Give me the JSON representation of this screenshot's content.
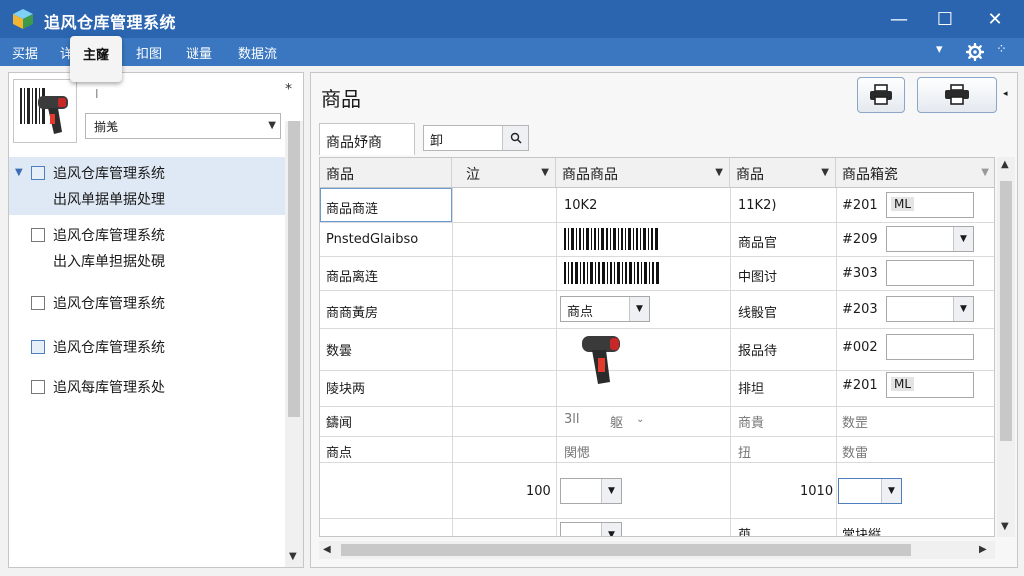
{
  "window": {
    "title": "追风仓库管理系统",
    "controls": {
      "minimize": "—",
      "maximize": "☐",
      "close": "✕"
    }
  },
  "menu": {
    "items": [
      "买据",
      "详",
      "扣图",
      "谜量",
      "数据流"
    ],
    "active_label": "主窿",
    "right_dropdown": "▾",
    "settings_icon": "gear-icon"
  },
  "left_panel": {
    "collapse_label": "⁎",
    "cursor_mark": "I",
    "combo_value": "揃羗",
    "list": [
      {
        "title": "追风仓库管理系统",
        "sub": "出风单据单据处理",
        "checked": true,
        "expanded": true,
        "selected": true
      },
      {
        "title": "追风仓库管理系统",
        "sub": "出入库单担据处硯",
        "checked": false,
        "expanded": false,
        "selected": false
      },
      {
        "title": "追风仓库管理系统",
        "sub": "",
        "checked": false,
        "expanded": false,
        "selected": false
      },
      {
        "title": "追风仓库管理系统",
        "sub": "",
        "checked": true,
        "expanded": false,
        "selected": false
      },
      {
        "title": "追风每库管理系处",
        "sub": "",
        "checked": false,
        "expanded": false,
        "selected": false
      }
    ]
  },
  "main": {
    "title": "商品",
    "toolbar": {
      "print_icon": "printer-icon",
      "print2_icon": "printer-alt-icon"
    },
    "tab_label": "商品妤商",
    "search": {
      "value": "卸",
      "icon": "search-icon"
    },
    "columns": [
      "商品",
      "泣",
      "商品商品",
      "商品",
      "商品箱瓷"
    ],
    "rows": [
      {
        "c1": "商品商涟",
        "c3": "10K2",
        "c4": "11K2)",
        "c5": "#201",
        "c5_input": "ML"
      },
      {
        "c1": "PnstedGlaibso",
        "c3": "barcode",
        "c4": "商品官",
        "c5": "#209",
        "c5_combo": ""
      },
      {
        "c1": "商品离连",
        "c3": "barcode",
        "c4": "中图讨",
        "c5": "#303",
        "c5_input": ""
      },
      {
        "c1": "商商黃房",
        "c3_combo": "商点",
        "c4": "线骰官",
        "c5": "#203",
        "c5_combo": ""
      },
      {
        "c1": "数曇",
        "c3": "scanner",
        "c4": "报品待",
        "c5": "#002",
        "c5_input": ""
      },
      {
        "c1": "陵块两",
        "c4": "排坦",
        "c5": "#201",
        "c5_input": "ML"
      },
      {
        "c1": "鑄闻",
        "c3": "3ll",
        "c3b": "躯",
        "c4": "商貴",
        "c5": "数罡"
      },
      {
        "c1": "商点",
        "c3": "関愢",
        "c4": "扭",
        "c5": "数雷"
      },
      {
        "c2": "100",
        "c3_combo": "",
        "c4": "1010",
        "c5_combo": ""
      },
      {
        "c3_combo": "",
        "c4": "萸",
        "c5": "常块縦"
      }
    ]
  },
  "colors": {
    "titlebar": "#2b65b0",
    "menubar": "#3a77c0",
    "selection": "#dfe9f5"
  }
}
